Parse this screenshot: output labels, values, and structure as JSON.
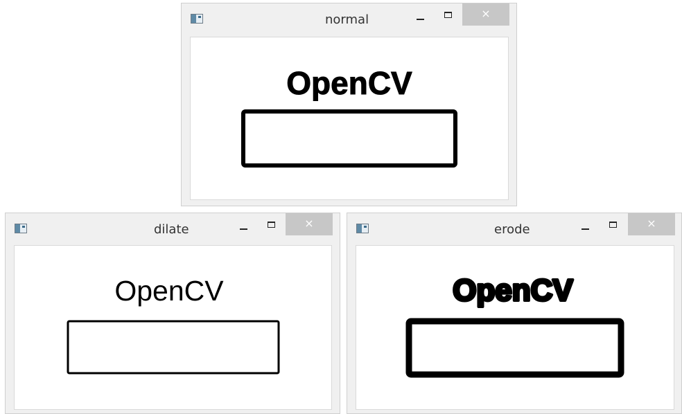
{
  "windows": [
    {
      "title": "normal",
      "image_text": "OpenCV",
      "close_label": "×"
    },
    {
      "title": "dilate",
      "image_text": "OpenCV",
      "close_label": "×"
    },
    {
      "title": "erode",
      "image_text": "OpenCV",
      "close_label": "×"
    }
  ],
  "colors": {
    "window_frame": "#f0f0f0",
    "close_button": "#c7c7c7",
    "image_background": "#ffffff",
    "ink": "#000000"
  }
}
